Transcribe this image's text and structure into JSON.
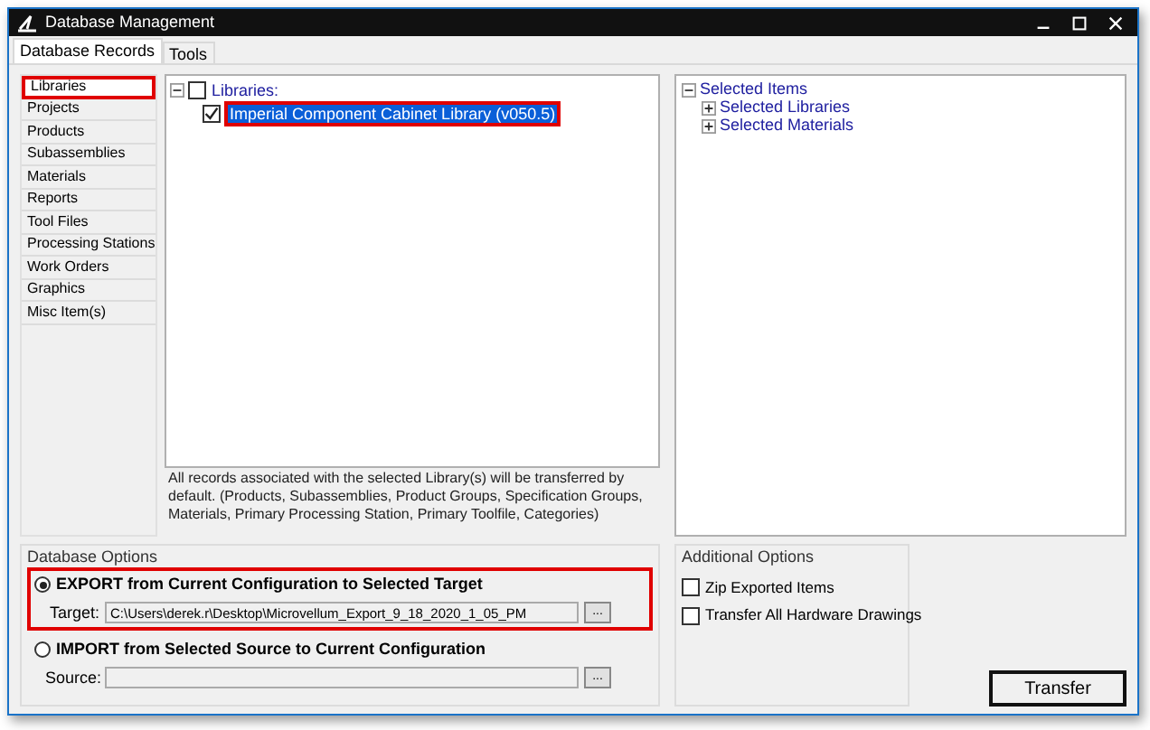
{
  "window": {
    "title": "Database Management"
  },
  "tabs": [
    {
      "label": "Database Records",
      "selected": true
    },
    {
      "label": "Tools",
      "selected": false
    }
  ],
  "sidebar": {
    "items": [
      {
        "label": "Libraries",
        "selected": true,
        "highlighted": true
      },
      {
        "label": "Projects",
        "selected": false,
        "highlighted": false
      },
      {
        "label": "Products",
        "selected": false,
        "highlighted": false
      },
      {
        "label": "Subassemblies",
        "selected": false,
        "highlighted": false
      },
      {
        "label": "Materials",
        "selected": false,
        "highlighted": false
      },
      {
        "label": "Reports",
        "selected": false,
        "highlighted": false
      },
      {
        "label": "Tool Files",
        "selected": false,
        "highlighted": false
      },
      {
        "label": "Processing Stations",
        "selected": false,
        "highlighted": false
      },
      {
        "label": "Work Orders",
        "selected": false,
        "highlighted": false
      },
      {
        "label": "Graphics",
        "selected": false,
        "highlighted": false
      },
      {
        "label": "Misc Item(s)",
        "selected": false,
        "highlighted": false
      }
    ]
  },
  "library_tree": [
    {
      "label": "Libraries:",
      "checked": false,
      "expanded": true,
      "selected": false,
      "highlighted": false,
      "children": [
        {
          "label": "Imperial Component Cabinet Library (v050.5)",
          "checked": true,
          "selected": true,
          "highlighted": true
        }
      ]
    }
  ],
  "library_note": "All records associated with the selected Library(s) will be transferred by default.  (Products, Subassemblies, Product Groups, Specification Groups, Materials, Primary Processing Station, Primary Toolfile, Categories)",
  "selected_tree": [
    {
      "label": "Selected Items",
      "expanded": true,
      "children": [
        {
          "label": "Selected Libraries",
          "expanded": false
        },
        {
          "label": "Selected Materials",
          "expanded": false
        }
      ]
    }
  ],
  "database_options": {
    "title": "Database Options",
    "options": [
      {
        "label": "EXPORT from Current Configuration to Selected Target",
        "selected": true,
        "highlighted": true,
        "field_label": "Target:",
        "value": "C:\\Users\\derek.r\\Desktop\\Microvellum_Export_9_18_2020_1_05_PM",
        "browse": "..."
      },
      {
        "label": "IMPORT from Selected Source to Current Configuration",
        "selected": false,
        "highlighted": false,
        "field_label": "Source:",
        "browse": "..."
      }
    ]
  },
  "additional_options": {
    "title": "Additional Options",
    "items": [
      {
        "label": "Zip Exported Items",
        "checked": false
      },
      {
        "label": "Transfer All Hardware Drawings",
        "checked": false
      }
    ]
  },
  "transfer_button": "Transfer"
}
